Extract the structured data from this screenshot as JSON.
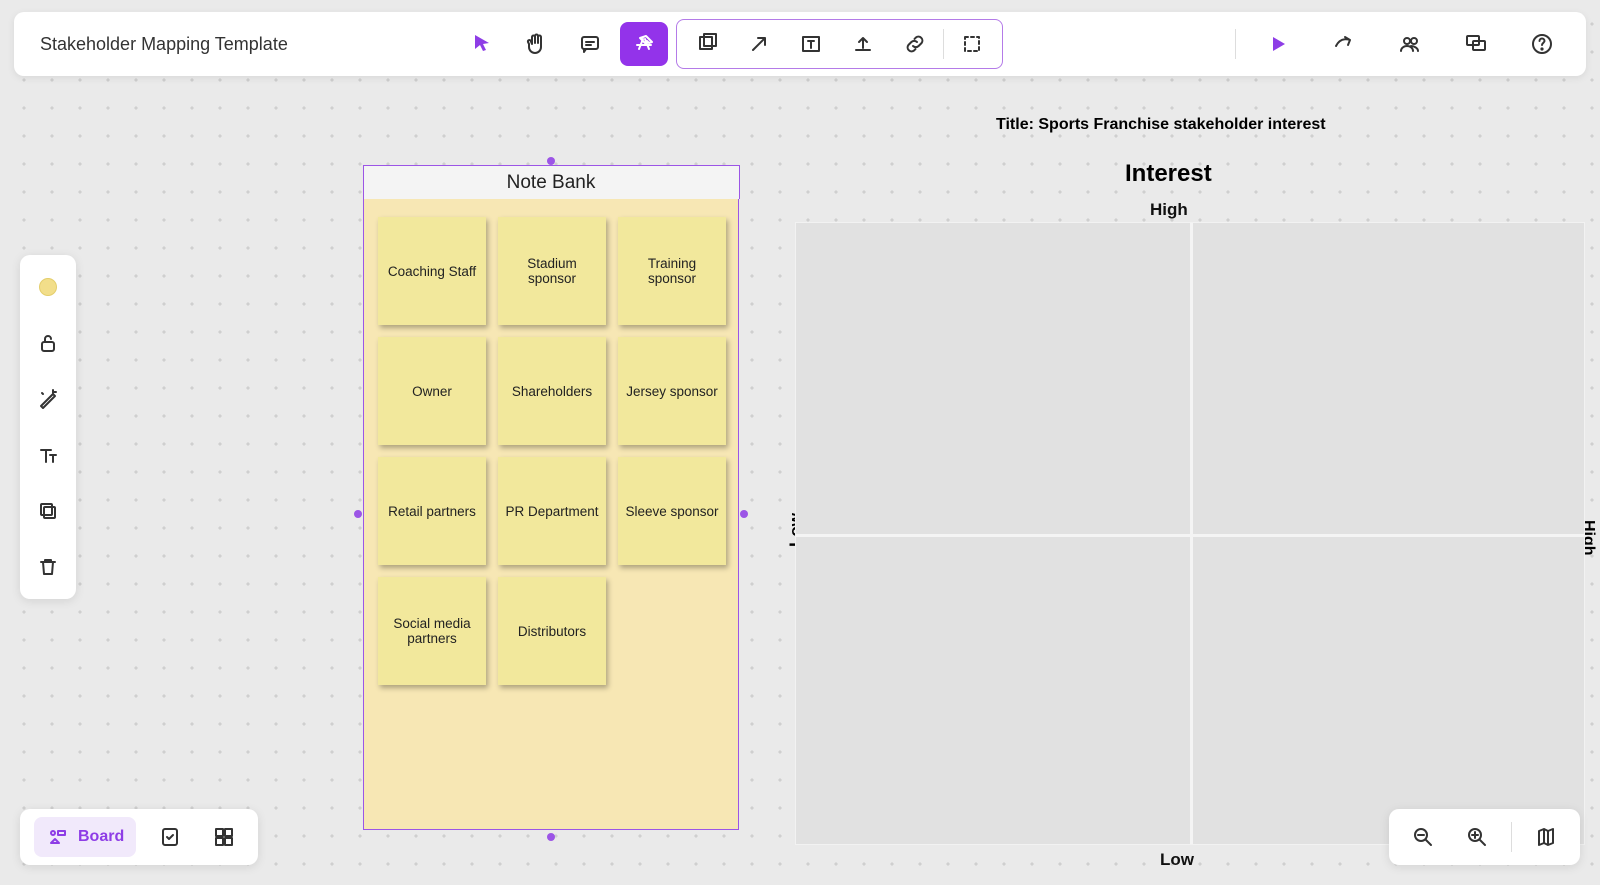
{
  "title": "Stakeholder Mapping Template",
  "notebank": {
    "header": "Note Bank",
    "notes": [
      "Coaching Staff",
      "Stadium sponsor",
      "Training sponsor",
      "Owner",
      "Shareholders",
      "Jersey sponsor",
      "Retail partners",
      "PR Department",
      "Sleeve sponsor",
      "Social media partners",
      "Distributors"
    ]
  },
  "chart_data": {
    "type": "scatter",
    "title": "Title: Sports Franchise stakeholder interest",
    "x_axis": {
      "label": "Interest",
      "low": "Low",
      "high": "High"
    },
    "y_axis": {
      "label": "Interest",
      "low": "Low",
      "high": "High"
    },
    "top_heading": "Interest",
    "quadrants": [
      [],
      [],
      [],
      []
    ],
    "series": []
  },
  "bottom": {
    "board_label": "Board"
  }
}
